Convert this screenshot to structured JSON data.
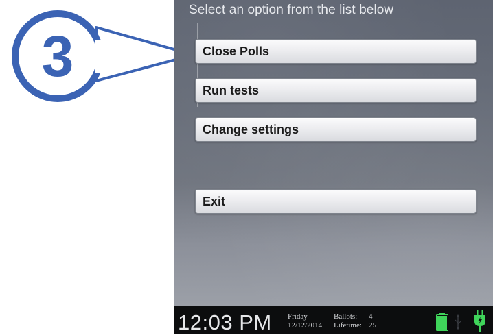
{
  "callout": {
    "step_number": "3"
  },
  "screen": {
    "prompt": "Select an option from the list below",
    "menu": {
      "close_polls": "Close Polls",
      "run_tests": "Run tests",
      "change_settings": "Change settings",
      "exit": "Exit"
    }
  },
  "status_bar": {
    "time": "12:03 PM",
    "day": "Friday",
    "date": "12/12/2014",
    "ballots_label": "Ballots:",
    "ballots_value": "4",
    "lifetime_label": "Lifetime:",
    "lifetime_value": "25",
    "icons": [
      "battery-icon",
      "usb-icon",
      "power-plug-icon"
    ],
    "accent_color": "#3fd45a"
  }
}
